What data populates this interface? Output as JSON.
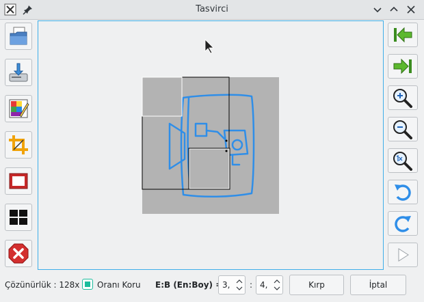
{
  "window": {
    "title": "Tasvirci"
  },
  "icons": {
    "app": "app-logo-icon",
    "pin": "pin-icon",
    "minimize": "chevron-down-icon",
    "maximize": "chevron-up-icon",
    "close": "close-icon",
    "left_tools": [
      "open-folder-icon",
      "save-icon",
      "color-palette-icon",
      "crop-icon",
      "frame-icon",
      "grid-icon",
      "cancel-icon"
    ],
    "right_tools": [
      "first-icon",
      "last-icon",
      "zoom-in-icon",
      "zoom-out-icon",
      "zoom-reset-icon",
      "rotate-left-icon",
      "rotate-right-icon",
      "play-icon"
    ]
  },
  "colors": {
    "accent": "#3daee9",
    "sketch_blue": "#2f8ee8",
    "selection_gray": "#b3b3b3",
    "checkbox_teal": "#1abc9c"
  },
  "bottom": {
    "resolution_label": "Çözünürlük : 128x",
    "keep_ratio_label": "Oranı Koru",
    "keep_ratio_checked": true,
    "ratio_label": "E:B (En:Boy) =",
    "width_value": "3,",
    "height_value": "4,",
    "separator": ":",
    "crop_button": "Kırp",
    "cancel_button": "İptal"
  }
}
